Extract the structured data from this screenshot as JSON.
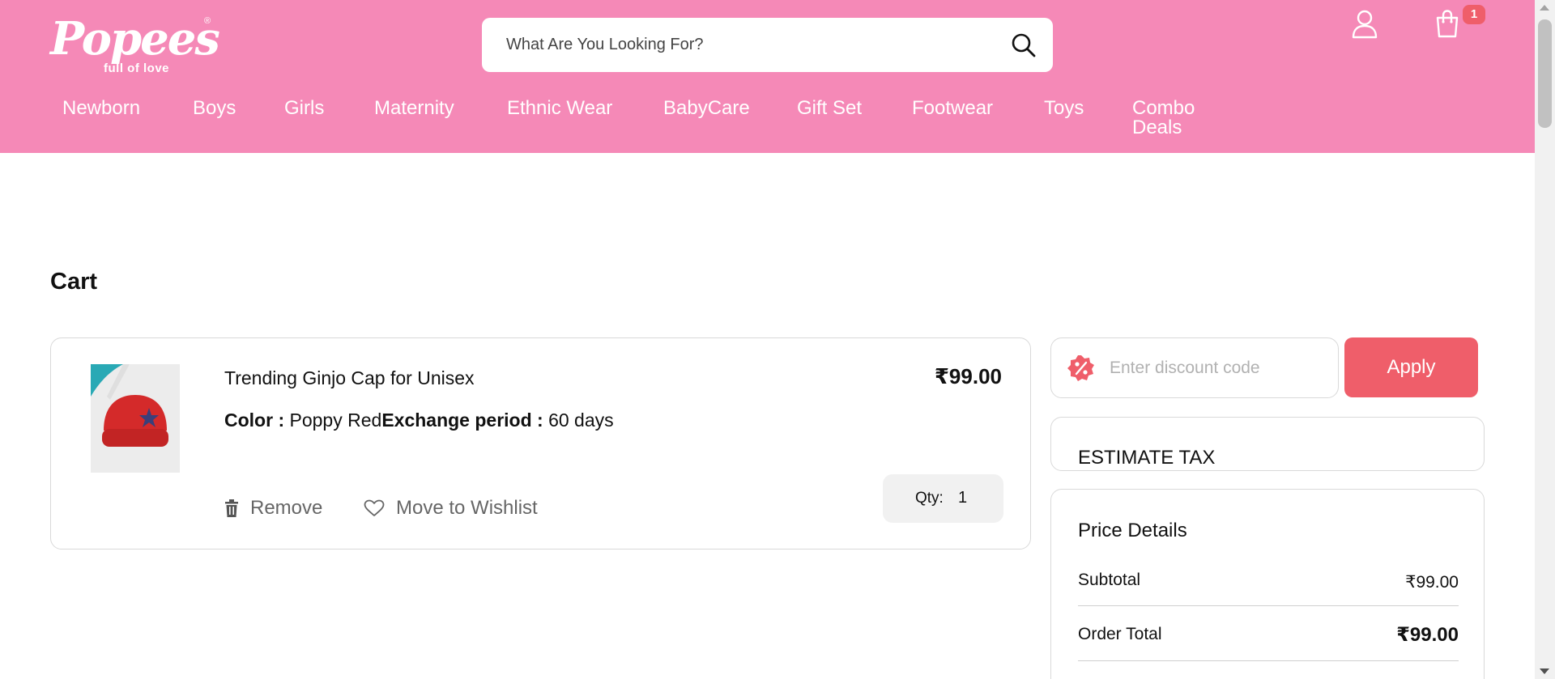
{
  "header": {
    "logo_text": "Popees",
    "logo_tagline": "full of love",
    "logo_reg": "®",
    "search_placeholder": "What Are You Looking For?",
    "cart_count": "1"
  },
  "nav": {
    "items": [
      "Newborn",
      "Boys",
      "Girls",
      "Maternity",
      "Ethnic Wear",
      "BabyCare",
      "Gift Set",
      "Footwear",
      "Toys",
      "Combo Deals"
    ]
  },
  "cart": {
    "title": "Cart",
    "item": {
      "name": "Trending Ginjo Cap for Unisex",
      "price": "₹99.00",
      "color_label": "Color :",
      "color_value": "Poppy Red",
      "exchange_label": "Exchange period :",
      "exchange_value": "60 days",
      "remove_label": "Remove",
      "wishlist_label": "Move to Wishlist",
      "qty_label": "Qty:",
      "qty_value": "1"
    }
  },
  "discount": {
    "placeholder": "Enter discount code",
    "apply_label": "Apply"
  },
  "estimate_tax": {
    "label": "ESTIMATE TAX"
  },
  "price_details": {
    "title": "Price Details",
    "subtotal_label": "Subtotal",
    "subtotal_value": "₹99.00",
    "order_total_label": "Order Total",
    "order_total_value": "₹99.00"
  },
  "colors": {
    "header_bg": "#f589b7",
    "accent": "#ef5e6a",
    "product_red": "#d42a2a",
    "star_navy": "#3a3f7a"
  },
  "icons": [
    "search-icon",
    "user-icon",
    "shopping-bag-icon",
    "trash-icon",
    "heart-icon",
    "percent-badge-icon"
  ]
}
